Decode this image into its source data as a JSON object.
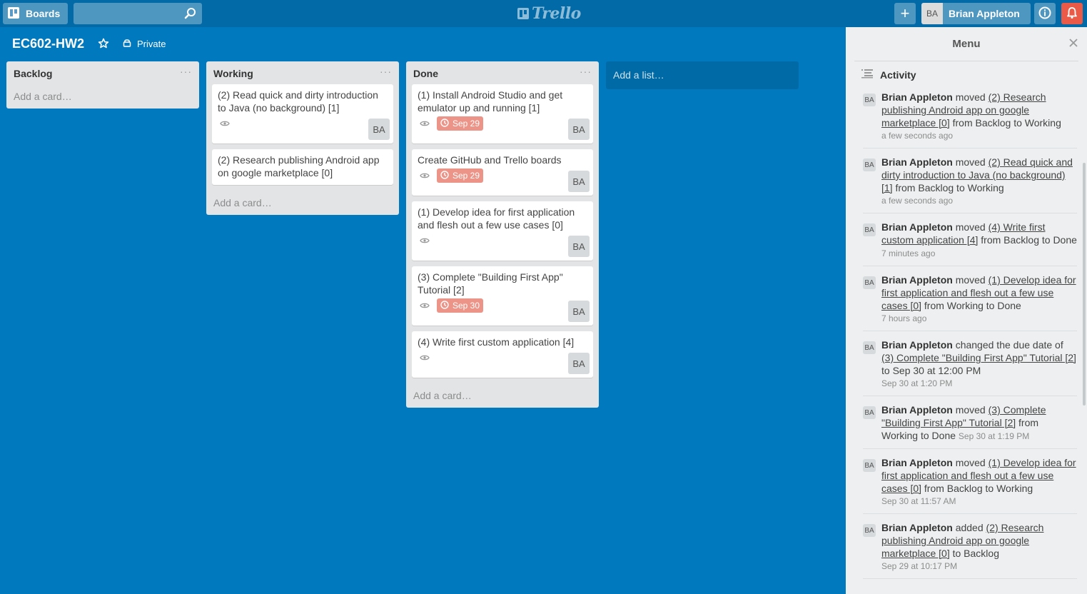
{
  "header": {
    "boards_label": "Boards",
    "search_placeholder": "",
    "logo_text": "Trello",
    "add_label": "+",
    "user_initials": "BA",
    "user_name": "Brian Appleton"
  },
  "board": {
    "title": "EC602-HW2",
    "privacy": "Private"
  },
  "lists": [
    {
      "title": "Backlog",
      "menu": "···",
      "add_card": "Add a card…",
      "cards": []
    },
    {
      "title": "Working",
      "menu": "···",
      "add_card": "Add a card…",
      "cards": [
        {
          "title": "(2) Read quick and dirty introduction to Java (no background) [1]",
          "due": "",
          "member": "BA",
          "watched": true
        },
        {
          "title": "(2) Research publishing Android app on google marketplace [0]",
          "due": "",
          "member": "",
          "watched": false
        }
      ]
    },
    {
      "title": "Done",
      "menu": "···",
      "add_card": "Add a card…",
      "cards": [
        {
          "title": "(1) Install Android Studio and get emulator up and running [1]",
          "due": "Sep 29",
          "member": "BA",
          "watched": true
        },
        {
          "title": "Create GitHub and Trello boards",
          "due": "Sep 29",
          "member": "BA",
          "watched": true
        },
        {
          "title": "(1) Develop idea for first application and flesh out a few use cases [0]",
          "due": "",
          "member": "BA",
          "watched": true
        },
        {
          "title": "(3) Complete \"Building First App\" Tutorial [2]",
          "due": "Sep 30",
          "member": "BA",
          "watched": true
        },
        {
          "title": "(4) Write first custom application [4]",
          "due": "",
          "member": "BA",
          "watched": true
        }
      ]
    }
  ],
  "add_list": "Add a list…",
  "menu": {
    "title": "Menu",
    "activity_label": "Activity",
    "items": [
      {
        "initials": "BA",
        "who": "Brian Appleton",
        "verb": " moved ",
        "link": "(2) Research publishing Android app on google marketplace [0]",
        "rest": " from Backlog to Working",
        "time": "a few seconds ago"
      },
      {
        "initials": "BA",
        "who": "Brian Appleton",
        "verb": " moved ",
        "link": "(2) Read quick and dirty introduction to Java (no background) [1]",
        "rest": " from Backlog to Working",
        "time": "a few seconds ago"
      },
      {
        "initials": "BA",
        "who": "Brian Appleton",
        "verb": " moved ",
        "link": "(4) Write first custom application [4]",
        "rest": " from Backlog to Done",
        "time": "7 minutes ago"
      },
      {
        "initials": "BA",
        "who": "Brian Appleton",
        "verb": " moved ",
        "link": "(1) Develop idea for first application and flesh out a few use cases [0]",
        "rest": " from Working to Done",
        "time": "7 hours ago"
      },
      {
        "initials": "BA",
        "who": "Brian Appleton",
        "verb": " changed the due date of ",
        "link": "(3) Complete \"Building First App\" Tutorial [2]",
        "rest": " to Sep 30 at 12:00 PM",
        "time": "Sep 30 at 1:20 PM"
      },
      {
        "initials": "BA",
        "who": "Brian Appleton",
        "verb": " moved ",
        "link": "(3) Complete \"Building First App\" Tutorial [2]",
        "rest": " from Working to Done",
        "time": "Sep 30 at 1:19 PM"
      },
      {
        "initials": "BA",
        "who": "Brian Appleton",
        "verb": " moved ",
        "link": "(1) Develop idea for first application and flesh out a few use cases [0]",
        "rest": " from Backlog to Working",
        "time": "Sep 30 at 11:57 AM"
      },
      {
        "initials": "BA",
        "who": "Brian Appleton",
        "verb": " added ",
        "link": "(2) Research publishing Android app on google marketplace [0]",
        "rest": " to Backlog",
        "time": "Sep 29 at 10:17 PM"
      }
    ]
  },
  "icons": {
    "boards": "boards-icon",
    "search": "search-icon",
    "info": "info-icon",
    "notifications": "bell-icon",
    "star": "star-icon",
    "privacy": "lock-icon",
    "watch": "eye-icon",
    "due": "clock-icon",
    "close": "close-icon",
    "activity": "list-icon"
  },
  "colors": {
    "board_bg": "#0079bf",
    "header_bg": "#026aa7",
    "due_badge": "#ec9488",
    "notification": "#eb5a46"
  }
}
